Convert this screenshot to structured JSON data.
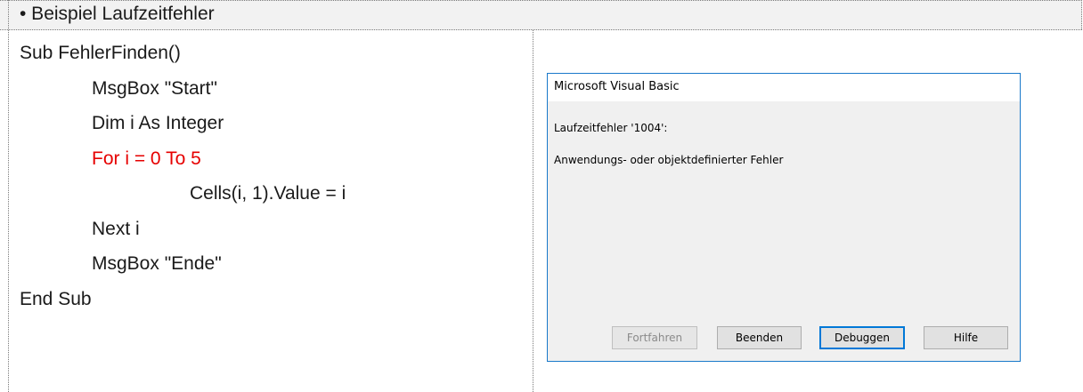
{
  "header": {
    "title": "• Beispiel Laufzeitfehler"
  },
  "code": {
    "lines": [
      "Sub FehlerFinden()",
      "MsgBox \"Start\"",
      "Dim i As Integer",
      "For i = 0 To 5",
      "Cells(i, 1).Value = i",
      "Next i",
      "MsgBox \"Ende\"",
      "End Sub"
    ]
  },
  "dialog": {
    "title": "Microsoft Visual Basic",
    "error_code_line": "Laufzeitfehler '1004':",
    "error_message": "Anwendungs- oder objektdefinierter Fehler",
    "buttons": {
      "continue": "Fortfahren",
      "end": "Beenden",
      "debug": "Debuggen",
      "help": "Hilfe"
    }
  },
  "colors": {
    "error_line": "#e60000",
    "header_bg": "#f2f2f2",
    "dialog_border": "#1979ca",
    "dialog_bg": "#f0f0f0",
    "default_button_border": "#0078d7"
  }
}
